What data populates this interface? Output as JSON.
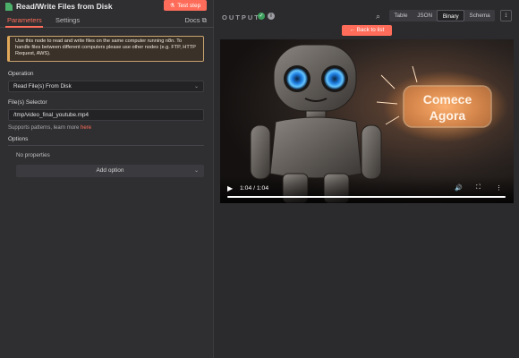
{
  "left": {
    "title": "Read/Write Files from Disk",
    "test_button": "Test step",
    "tabs": {
      "parameters": "Parameters",
      "settings": "Settings",
      "docs": "Docs"
    },
    "notice": "Use this node to read and write files on the same computer running n8n. To handle files between different computers please use other nodes (e.g. FTP, HTTP Request, AWS).",
    "operation_label": "Operation",
    "operation_value": "Read File(s) From Disk",
    "file_selector_label": "File(s) Selector",
    "file_selector_value": "/tmp/video_final_youtube.mp4",
    "hint_prefix": "Supports patterns, learn more ",
    "hint_link": "here",
    "options_label": "Options",
    "no_properties": "No properties",
    "add_option": "Add option"
  },
  "right": {
    "output_label": "OUTPUT",
    "view_tabs": [
      "Table",
      "JSON",
      "Binary",
      "Schema"
    ],
    "active_view": "Binary",
    "back_button": "Back to list",
    "video": {
      "time_display": "1:04 / 1:04",
      "sign_text_line1": "Comece",
      "sign_text_line2": "Agora",
      "progress": 1.0
    }
  },
  "colors": {
    "accent": "#ff6d5a",
    "success": "#3ea05d",
    "panel": "#2f2f31"
  }
}
